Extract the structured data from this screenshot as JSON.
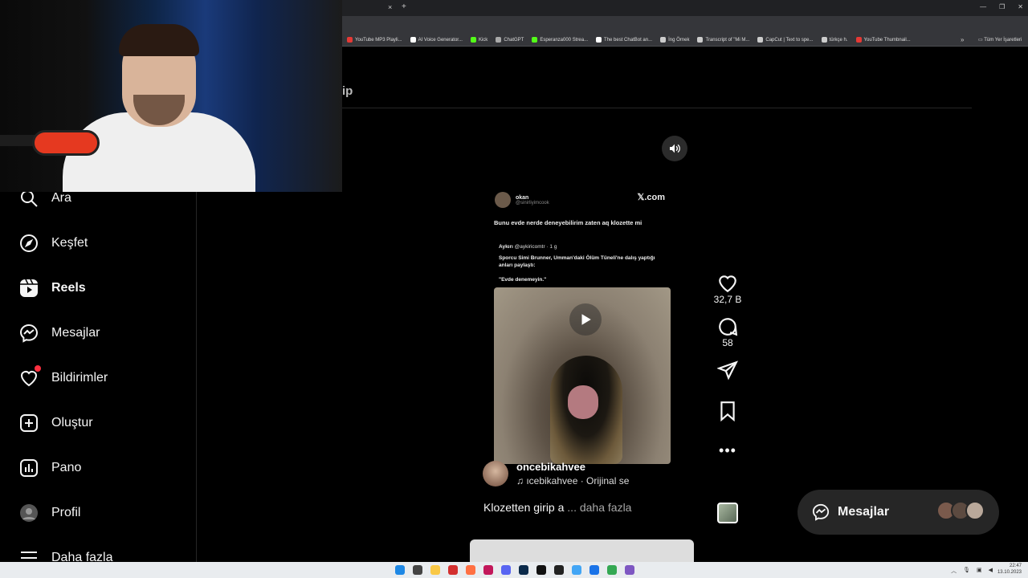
{
  "browser": {
    "tab_close": "×",
    "tab_new": "+",
    "bookmarks": [
      {
        "label": "YouTube MP3 Playli...",
        "color": "#e53935"
      },
      {
        "label": "AI Voice Generator...",
        "color": "#ffffff"
      },
      {
        "label": "Kick",
        "color": "#53fc18"
      },
      {
        "label": "ChatGPT",
        "color": "#aaaaaa"
      },
      {
        "label": "Esperanza000 Strea...",
        "color": "#53fc18"
      },
      {
        "label": "The best ChatBot an...",
        "color": "#ffffff"
      },
      {
        "label": "İng Örnek",
        "color": "#cccccc"
      },
      {
        "label": "Transcript of \"Mi M...",
        "color": "#cccccc"
      },
      {
        "label": "CapCut | Text to spe...",
        "color": "#cccccc"
      },
      {
        "label": "türkçe h.",
        "color": "#cccccc"
      },
      {
        "label": "YouTube Thumbnail...",
        "color": "#e53935"
      }
    ],
    "bookmarks_more": "»",
    "all_bookmarks": "Tüm Yer İşaretleri",
    "profile_initial": "U"
  },
  "header": {
    "partial_title": "ip"
  },
  "sidebar": {
    "items": [
      {
        "label": "Ara",
        "icon": "search-icon"
      },
      {
        "label": "Keşfet",
        "icon": "compass-icon"
      },
      {
        "label": "Reels",
        "icon": "reels-icon",
        "active": true
      },
      {
        "label": "Mesajlar",
        "icon": "messenger-icon"
      },
      {
        "label": "Bildirimler",
        "icon": "heart-icon"
      },
      {
        "label": "Oluştur",
        "icon": "plus-square-icon"
      },
      {
        "label": "Pano",
        "icon": "dashboard-icon"
      },
      {
        "label": "Profil",
        "icon": "avatar"
      },
      {
        "label": "Daha fazla",
        "icon": "menu-icon"
      }
    ]
  },
  "reel": {
    "tweet": {
      "name": "okan",
      "handle": "@sinirliyimcook",
      "site": "𝕏.com",
      "text": "Bunu evde nerde deneyebilirim zaten aq klozette mi",
      "quote_name": "Aykırı",
      "quote_handle": "@aykiricomtr · 1 g",
      "quote_text": "Sporcu Simi Brunner, Umman'daki Ölüm Tüneli'ne dalış yaptığı anları paylaştı:",
      "quote_sub": "\"Evde denemeyin.\""
    },
    "author": "oncebikahvee",
    "audio": "♫ ıcebikahvee · Orijinal se",
    "caption": "Klozetten girip a",
    "caption_more": "... daha fazla",
    "likes": "32,7 B",
    "comments": "58"
  },
  "messages_pill": {
    "label": "Mesajlar"
  },
  "taskbar": {
    "time": "22:47",
    "date": "13.10.2023"
  }
}
